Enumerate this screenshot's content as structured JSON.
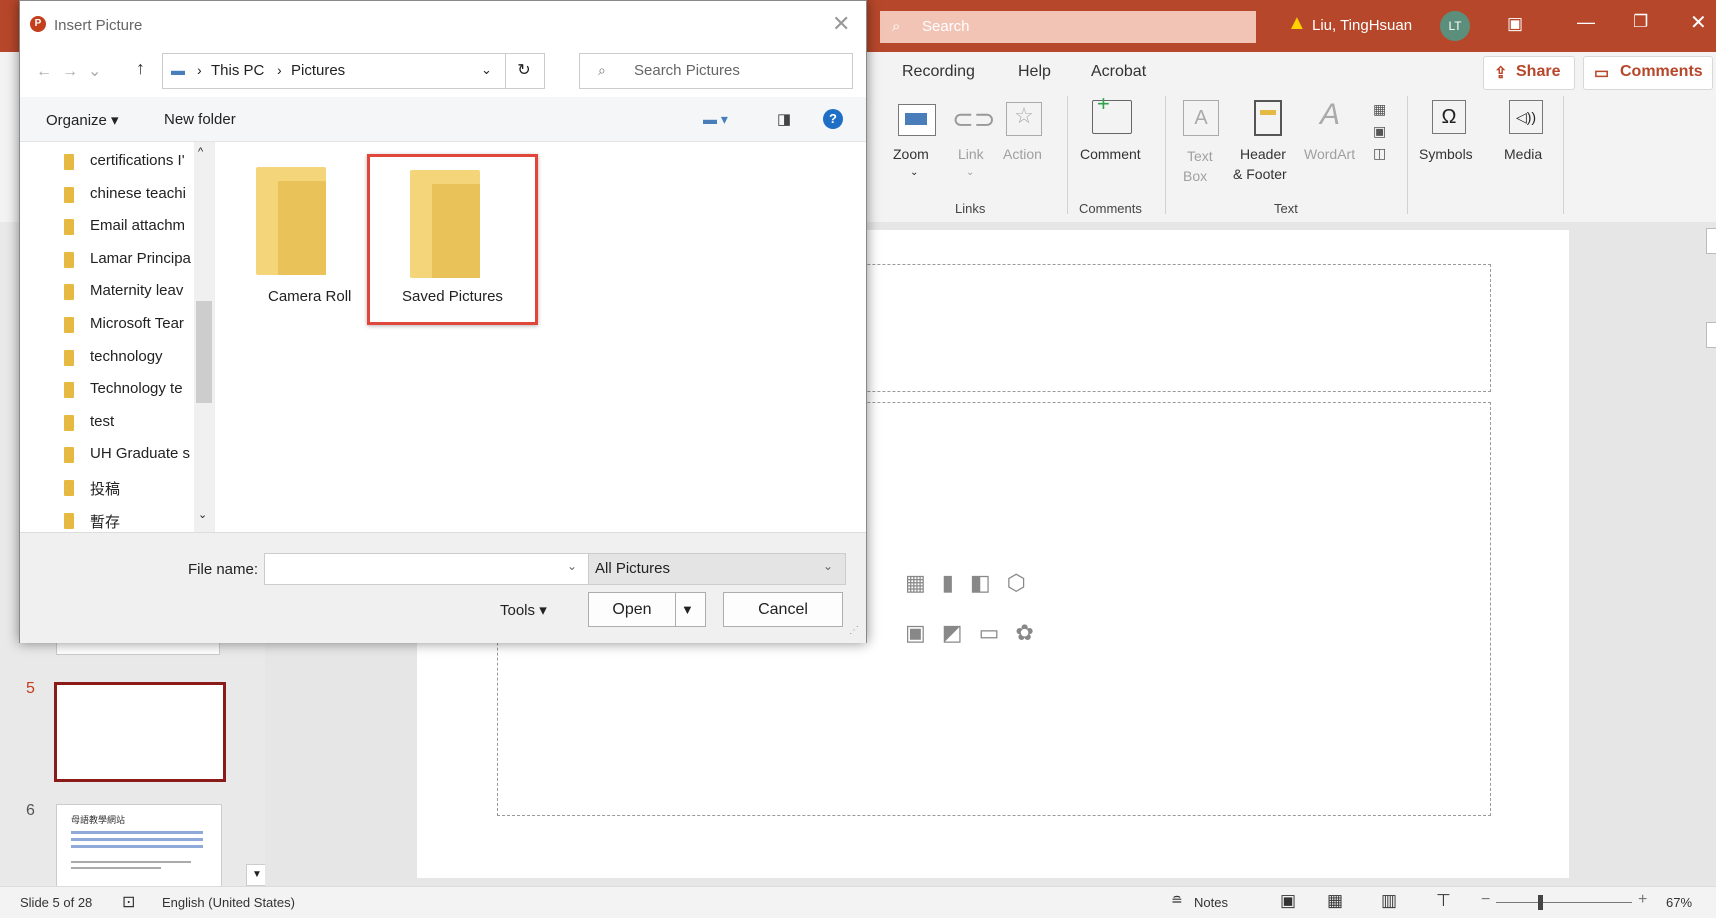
{
  "titlebar": {
    "search_placeholder": "Search",
    "user_name": "Liu, TingHsuan",
    "user_initials": "LT",
    "accent": "#b7472a"
  },
  "tabs": {
    "recording": "Recording",
    "help": "Help",
    "acrobat": "Acrobat",
    "share": "Share",
    "comments": "Comments"
  },
  "ribbon": {
    "zoom": "Zoom",
    "link": "Link",
    "action": "Action",
    "links_group": "Links",
    "comment": "Comment",
    "comments_group": "Comments",
    "text_box_1": "Text",
    "text_box_2": "Box",
    "header_1": "Header",
    "header_2": "& Footer",
    "wordart": "WordArt",
    "text_group": "Text",
    "symbols": "Symbols",
    "media": "Media"
  },
  "thumbs": {
    "slide5_num": "5",
    "slide6_num": "6",
    "slide6_title": "母語教學網站"
  },
  "statusbar": {
    "slide_info": "Slide 5 of 28",
    "language": "English (United States)",
    "notes": "Notes",
    "zoom_level": "67%"
  },
  "dialog": {
    "title": "Insert Picture",
    "breadcrumb_1": "This PC",
    "breadcrumb_2": "Pictures",
    "search_placeholder": "Search Pictures",
    "organize": "Organize",
    "new_folder": "New folder",
    "nav_items": [
      "certifications I'",
      "chinese teachi",
      "Email attachm",
      "Lamar Principa",
      "Maternity leav",
      "Microsoft Tear",
      "technology",
      "Technology te",
      "test",
      "UH Graduate s",
      "投稿",
      "暫存"
    ],
    "folders": [
      "Camera Roll",
      "Saved Pictures"
    ],
    "file_name_label": "File name:",
    "file_name_value": "",
    "file_type": "All Pictures",
    "tools": "Tools",
    "open": "Open",
    "cancel": "Cancel",
    "highlight_color": "#e0473a"
  }
}
